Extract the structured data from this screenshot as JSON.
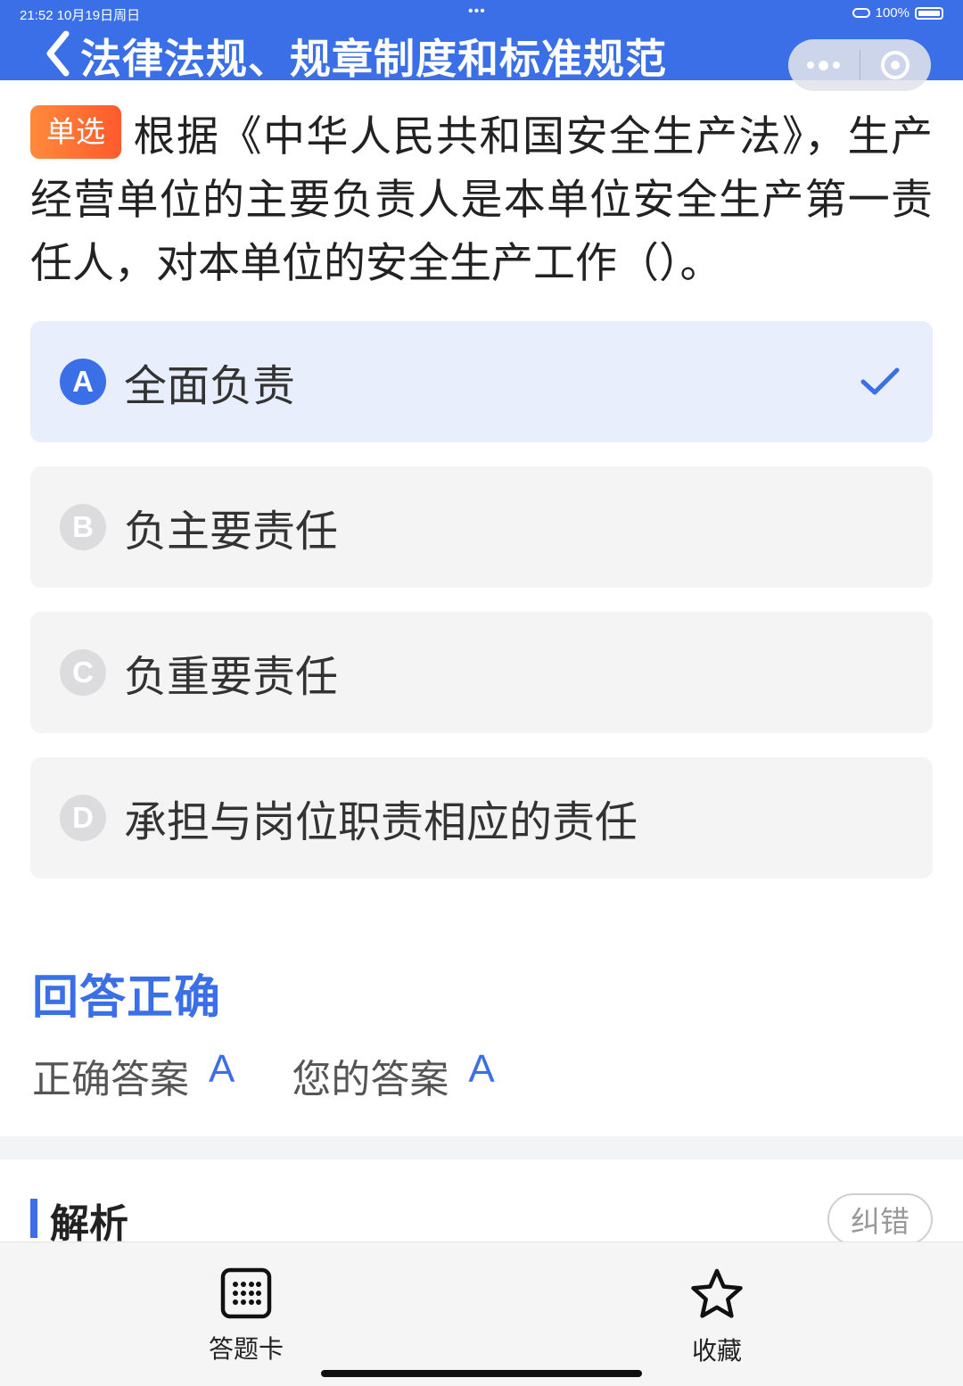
{
  "status_bar": {
    "time_date": "21:52   10月19日周日",
    "center_dots": "•••",
    "battery": "100%"
  },
  "header": {
    "title": "法律法规、规章制度和标准规范",
    "accent_color": "#3a6fe8"
  },
  "question": {
    "type_badge": "单选",
    "text": "根据《中华人民共和国安全生产法》，生产经营单位的主要负责人是本单位安全生产第一责任人，对本单位的安全生产工作（）。"
  },
  "options": [
    {
      "letter": "A",
      "text": "全面负责",
      "selected": true
    },
    {
      "letter": "B",
      "text": "负主要责任",
      "selected": false
    },
    {
      "letter": "C",
      "text": "负重要责任",
      "selected": false
    },
    {
      "letter": "D",
      "text": "承担与岗位职责相应的责任",
      "selected": false
    }
  ],
  "result": {
    "title": "回答正确",
    "correct_label": "正确答案",
    "correct_value": "A",
    "your_label": "您的答案",
    "your_value": "A"
  },
  "analysis": {
    "title": "解析",
    "report_button": "纠错"
  },
  "bottom_bar": {
    "answer_card": "答题卡",
    "favorite": "收藏"
  },
  "icons": {
    "back": "chevron-left-icon",
    "more": "more-dots-icon",
    "close": "target-icon",
    "check": "check-icon",
    "answer_card": "grid-icon",
    "favorite": "star-icon"
  }
}
